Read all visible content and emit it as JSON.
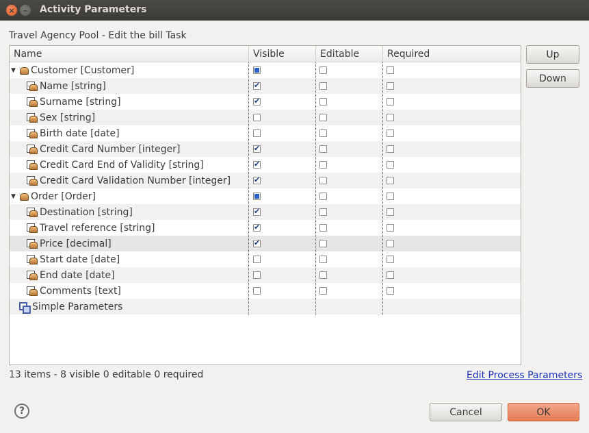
{
  "window": {
    "title": "Activity Parameters",
    "close_glyph": "×",
    "min_glyph": "–"
  },
  "subtitle": "Travel Agency Pool  - Edit the bill Task",
  "table": {
    "columns": [
      "Name",
      "Visible",
      "Editable",
      "Required"
    ],
    "rows": [
      {
        "label": "Customer [Customer]",
        "type": "group",
        "visible": "partial",
        "editable": false,
        "required": false,
        "icon": "object-icon"
      },
      {
        "label": "Name [string]",
        "type": "field",
        "visible": true,
        "editable": false,
        "required": false,
        "icon": "field-icon"
      },
      {
        "label": "Surname [string]",
        "type": "field",
        "visible": true,
        "editable": false,
        "required": false,
        "icon": "field-icon"
      },
      {
        "label": "Sex [string]",
        "type": "field",
        "visible": false,
        "editable": false,
        "required": false,
        "icon": "field-icon"
      },
      {
        "label": "Birth date [date]",
        "type": "field",
        "visible": false,
        "editable": false,
        "required": false,
        "icon": "field-icon"
      },
      {
        "label": "Credit Card Number [integer]",
        "type": "field",
        "visible": true,
        "editable": false,
        "required": false,
        "icon": "field-icon"
      },
      {
        "label": "Credit Card End of Validity [string]",
        "type": "field",
        "visible": true,
        "editable": false,
        "required": false,
        "icon": "field-icon"
      },
      {
        "label": "Credit Card Validation Number [integer]",
        "type": "field",
        "visible": true,
        "editable": false,
        "required": false,
        "icon": "field-icon"
      },
      {
        "label": "Order [Order]",
        "type": "group",
        "visible": "partial",
        "editable": false,
        "required": false,
        "icon": "object-icon"
      },
      {
        "label": "Destination [string]",
        "type": "field",
        "visible": true,
        "editable": false,
        "required": false,
        "icon": "field-icon"
      },
      {
        "label": "Travel reference [string]",
        "type": "field",
        "visible": true,
        "editable": false,
        "required": false,
        "icon": "field-icon"
      },
      {
        "label": "Price [decimal]",
        "type": "field",
        "visible": true,
        "editable": false,
        "required": false,
        "icon": "field-icon",
        "selected": true
      },
      {
        "label": "Start date [date]",
        "type": "field",
        "visible": false,
        "editable": false,
        "required": false,
        "icon": "field-icon"
      },
      {
        "label": "End date [date]",
        "type": "field",
        "visible": false,
        "editable": false,
        "required": false,
        "icon": "field-icon"
      },
      {
        "label": "Comments [text]",
        "type": "field",
        "visible": false,
        "editable": false,
        "required": false,
        "icon": "field-icon"
      },
      {
        "label": "Simple Parameters",
        "type": "simple",
        "icon": "simple-parameters-icon"
      }
    ]
  },
  "buttons": {
    "up": "Up",
    "down": "Down",
    "cancel": "Cancel",
    "ok": "OK"
  },
  "status": "13 items - 8 visible  0 editable  0 required",
  "link": "Edit Process Parameters",
  "help_glyph": "?",
  "expander_glyph": "▼",
  "colors": {
    "titlebar": "#3c3b37",
    "ok_button": "#e67c55",
    "link": "#1a32b8",
    "checkbox_check": "#1b3d78"
  }
}
